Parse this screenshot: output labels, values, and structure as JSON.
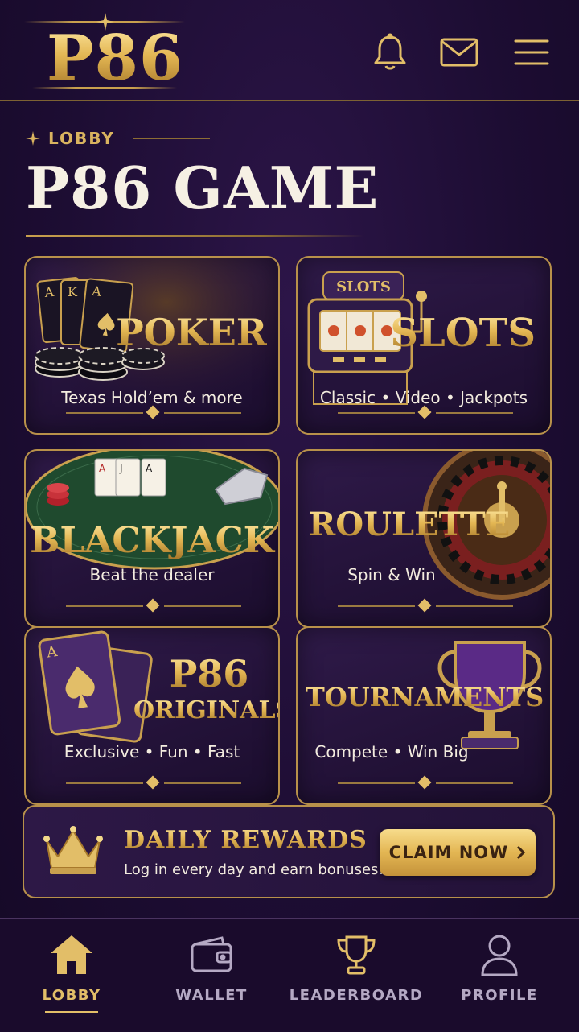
{
  "header": {
    "logo": "P86",
    "icons": [
      "bell-icon",
      "mail-icon",
      "menu-icon"
    ]
  },
  "lobby": {
    "eyebrow": "LOBBY",
    "title": "P86 GAME"
  },
  "games": [
    {
      "title": "POKER",
      "subtitle": "Texas Hold’em & more"
    },
    {
      "title": "SLOTS",
      "subtitle": "Classic • Video • Jackpots",
      "sign": "SLOTS"
    },
    {
      "title": "BLACKJACK",
      "subtitle": "Beat the dealer"
    },
    {
      "title": "ROULETTE",
      "subtitle": "Spin & Win"
    },
    {
      "title_line1": "P86",
      "title_line2": "ORIGINALS",
      "subtitle": "Exclusive • Fun • Fast"
    },
    {
      "title": "TOURNAMENTS",
      "subtitle": "Compete • Win Big"
    }
  ],
  "rewards": {
    "title": "DAILY REWARDS",
    "subtitle": "Log in every day and earn bonuses!",
    "button": "CLAIM NOW"
  },
  "nav": {
    "items": [
      {
        "label": "LOBBY",
        "icon": "home-icon",
        "active": true
      },
      {
        "label": "WALLET",
        "icon": "wallet-icon",
        "active": false
      },
      {
        "label": "LEADERBOARD",
        "icon": "trophy-icon",
        "active": false
      },
      {
        "label": "PROFILE",
        "icon": "user-icon",
        "active": false
      }
    ]
  },
  "colors": {
    "background": "#1d0d33",
    "gold": "#e2be68",
    "card_border": "#b8914a",
    "felt_green": "#1f4a2e"
  }
}
